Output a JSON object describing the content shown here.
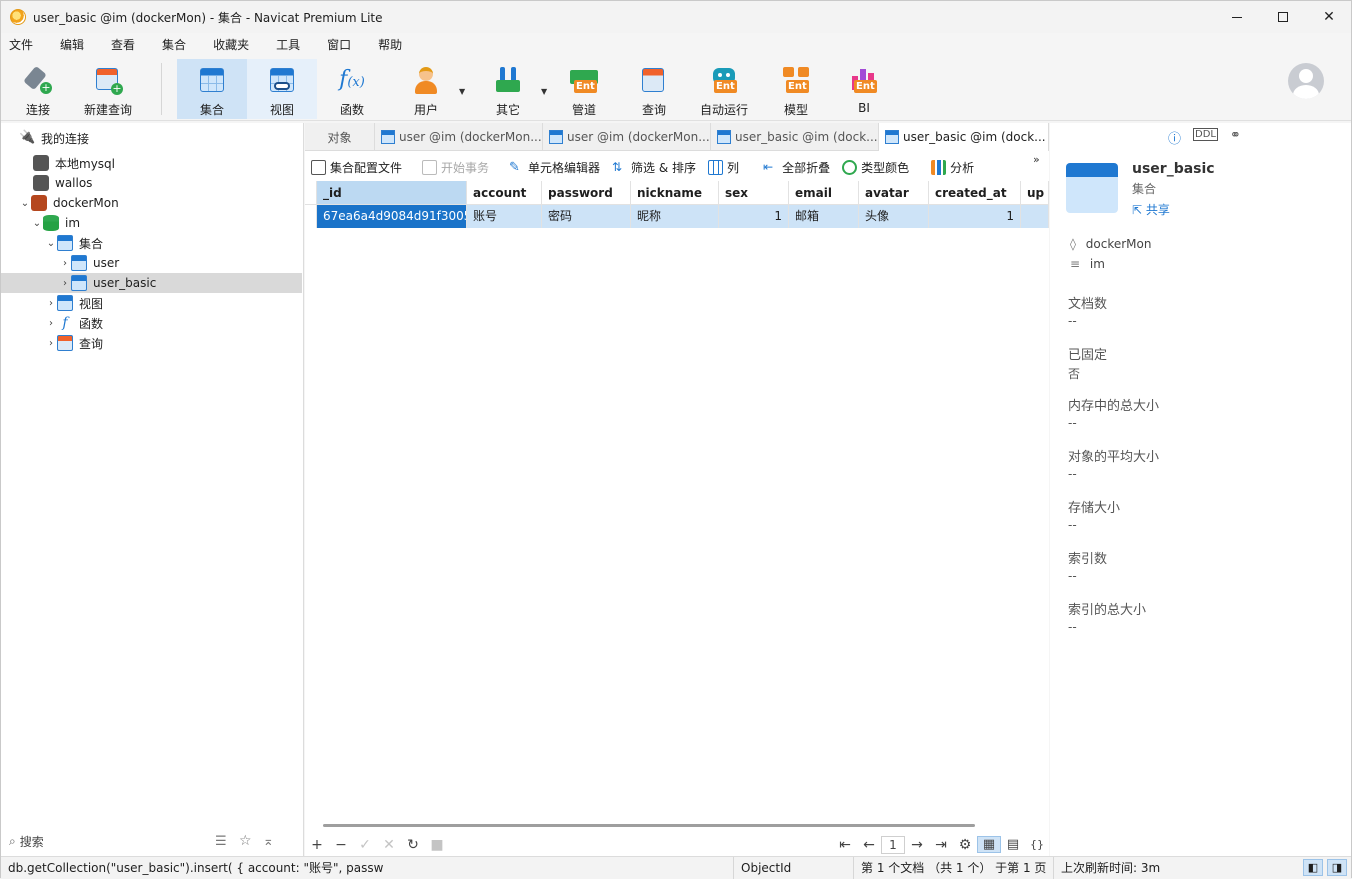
{
  "window": {
    "title": "user_basic @im (dockerMon) - 集合 - Navicat Premium Lite"
  },
  "menu": [
    "文件",
    "编辑",
    "查看",
    "集合",
    "收藏夹",
    "工具",
    "窗口",
    "帮助"
  ],
  "toolbar": {
    "connect": "连接",
    "new_query": "新建查询",
    "collection": "集合",
    "view": "视图",
    "function": "函数",
    "user": "用户",
    "other": "其它",
    "pipeline": "管道",
    "query": "查询",
    "automation": "自动运行",
    "model": "模型",
    "bi": "BI",
    "ent_badge": "Ent"
  },
  "tree": {
    "root": "我的连接",
    "items": [
      {
        "label": "本地mysql"
      },
      {
        "label": "wallos"
      },
      {
        "label": "dockerMon"
      },
      {
        "label": "im"
      },
      {
        "label": "集合"
      },
      {
        "label": "user"
      },
      {
        "label": "user_basic"
      },
      {
        "label": "视图"
      },
      {
        "label": "函数"
      },
      {
        "label": "查询"
      }
    ],
    "search_placeholder": "搜索"
  },
  "tabs": [
    "对象",
    "user @im (dockerMon...",
    "user @im (dockerMon...",
    "user_basic @im (dock...",
    "user_basic @im (dock..."
  ],
  "subtoolbar": {
    "config": "集合配置文件",
    "begin_tx": "开始事务",
    "cell_editor": "单元格编辑器",
    "filter_sort": "筛选 & 排序",
    "columns": "列",
    "collapse": "全部折叠",
    "type_color": "类型颜色",
    "analyze": "分析"
  },
  "grid": {
    "columns": [
      "_id",
      "account",
      "password",
      "nickname",
      "sex",
      "email",
      "avatar",
      "created_at",
      "up"
    ],
    "rows": [
      [
        "67ea6a4d9084d91f3005",
        "账号",
        "密码",
        "昵称",
        "1",
        "邮箱",
        "头像",
        "1",
        ""
      ]
    ]
  },
  "pager": {
    "page": "1"
  },
  "info": {
    "name": "user_basic",
    "type": "集合",
    "share": "共享",
    "connection": "dockerMon",
    "database": "im",
    "fields": [
      {
        "label": "文档数",
        "value": "--"
      },
      {
        "label": "已固定",
        "value": "否"
      },
      {
        "label": "内存中的总大小",
        "value": "--"
      },
      {
        "label": "对象的平均大小",
        "value": "--"
      },
      {
        "label": "存储大小",
        "value": "--"
      },
      {
        "label": "索引数",
        "value": "--"
      },
      {
        "label": "索引的总大小",
        "value": "--"
      }
    ]
  },
  "status": {
    "query": "db.getCollection(\"user_basic\").insert( { account: \"账号\", passw",
    "type": "ObjectId",
    "position": "第 1 个文档 （共 1 个） 于第 1 页",
    "refresh": "上次刷新时间: 3m"
  }
}
